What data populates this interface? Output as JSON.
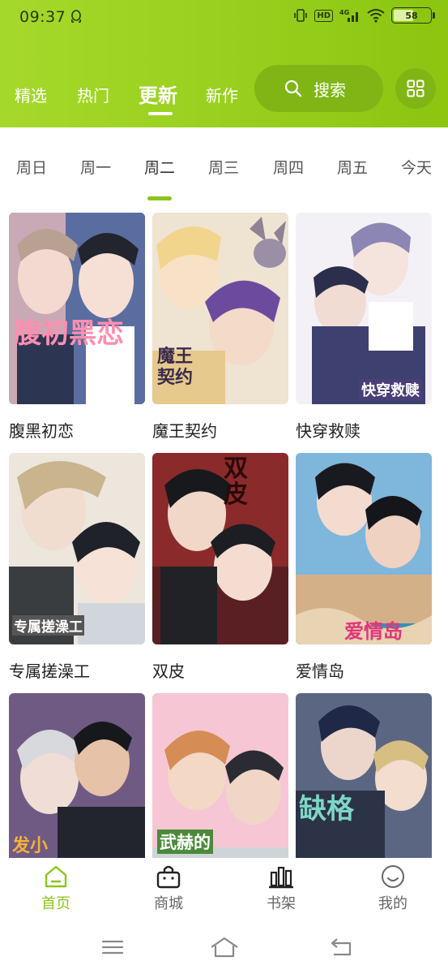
{
  "status_bar": {
    "time": "09:37",
    "hd_label": "HD",
    "network_label": "4G",
    "battery_level": "58",
    "icons": [
      "qq-icon",
      "vibrate-icon",
      "signal-icon",
      "wifi-icon",
      "battery-icon"
    ]
  },
  "header": {
    "tabs": [
      {
        "label": "精选",
        "active": false
      },
      {
        "label": "热门",
        "active": false
      },
      {
        "label": "更新",
        "active": true
      },
      {
        "label": "新作",
        "active": false
      }
    ],
    "search_label": "搜索",
    "accent_color": "#8cc51a"
  },
  "day_tabs": [
    {
      "label": "周日",
      "active": false
    },
    {
      "label": "周一",
      "active": false
    },
    {
      "label": "周二",
      "active": true
    },
    {
      "label": "周三",
      "active": false
    },
    {
      "label": "周四",
      "active": false
    },
    {
      "label": "周五",
      "active": false
    },
    {
      "label": "今天",
      "active": false
    }
  ],
  "comics": [
    {
      "title": "腹黑初恋",
      "cover_text": "腹初黑恋"
    },
    {
      "title": "魔王契约",
      "cover_text": "魔王契约"
    },
    {
      "title": "快穿救赎",
      "cover_text": "快穿救赎"
    },
    {
      "title": "专属搓澡工",
      "cover_text": "专属搓澡工"
    },
    {
      "title": "双皮",
      "cover_text": "双皮"
    },
    {
      "title": "爱情岛",
      "cover_text": "爱情岛"
    },
    {
      "title": "",
      "cover_text": "发小"
    },
    {
      "title": "",
      "cover_text": "武赫的"
    },
    {
      "title": "",
      "cover_text": "缺格"
    }
  ],
  "bottom_nav": [
    {
      "label": "首页",
      "icon": "home-icon",
      "active": true
    },
    {
      "label": "商城",
      "icon": "shop-bag-icon",
      "active": false
    },
    {
      "label": "书架",
      "icon": "bookshelf-icon",
      "active": false
    },
    {
      "label": "我的",
      "icon": "profile-smile-icon",
      "active": false
    }
  ],
  "system_nav": [
    "menu-icon",
    "home-outline-icon",
    "back-icon"
  ]
}
